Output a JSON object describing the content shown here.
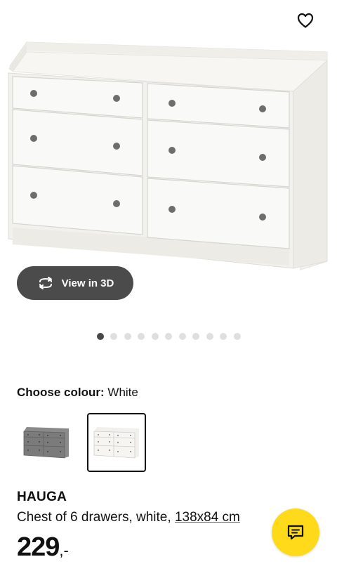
{
  "gallery": {
    "view_3d_label": "View in 3D",
    "image_count": 11,
    "active_index": 0
  },
  "colour": {
    "label": "Choose colour:",
    "selected": "White",
    "options": [
      {
        "name": "grey-dresser-swatch",
        "color": "#7d7d7d",
        "selected": false
      },
      {
        "name": "white-dresser-swatch",
        "color": "#f1f0ec",
        "selected": true
      }
    ]
  },
  "product": {
    "name": "HAUGA",
    "description": "Chest of 6 drawers, white,",
    "size_link": "138x84 cm",
    "price_integer": "229",
    "price_suffix": ",-"
  },
  "colors": {
    "chat_button": "#ffda1a",
    "view3d_button": "#4b4b4b",
    "dot_active": "#484848",
    "dot_inactive": "#dfdfdf"
  },
  "icons": [
    "heart-icon",
    "rotate-3d-icon",
    "chat-icon"
  ]
}
